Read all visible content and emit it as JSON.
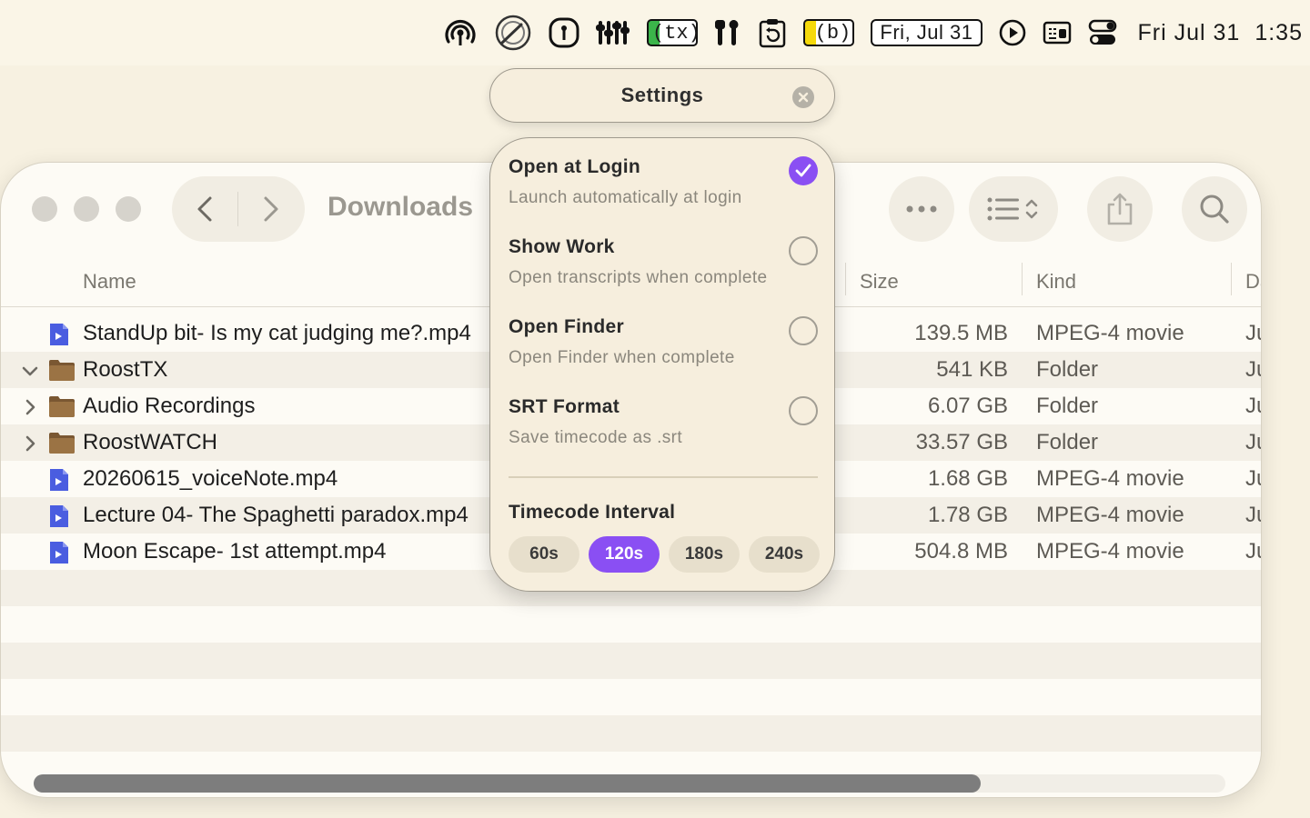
{
  "menubar": {
    "date_box": "Fri, Jul 31",
    "tx_label": "(tx)",
    "b_label": "(b)",
    "clock_date": "Fri Jul 31",
    "clock_time": "1:35"
  },
  "finder": {
    "title": "Downloads",
    "columns": {
      "name": "Name",
      "size": "Size",
      "kind": "Kind",
      "date": "Da"
    },
    "rows": [
      {
        "name": "StandUp bit- Is my cat judging me?.mp4",
        "size": "139.5 MB",
        "kind": "MPEG-4 movie",
        "date": "Ju",
        "type": "movie",
        "chevron": ""
      },
      {
        "name": "RoostTX",
        "size": "541 KB",
        "kind": "Folder",
        "date": "Ju",
        "type": "folder",
        "chevron": "expanded"
      },
      {
        "name": "Audio Recordings",
        "size": "6.07 GB",
        "kind": "Folder",
        "date": "Ju",
        "type": "folder",
        "chevron": "collapsed"
      },
      {
        "name": "RoostWATCH",
        "size": "33.57 GB",
        "kind": "Folder",
        "date": "Ju",
        "type": "folder",
        "chevron": "collapsed"
      },
      {
        "name": "20260615_voiceNote.mp4",
        "size": "1.68 GB",
        "kind": "MPEG-4 movie",
        "date": "Ju",
        "type": "movie",
        "chevron": ""
      },
      {
        "name": "Lecture 04- The Spaghetti paradox.mp4",
        "size": "1.78 GB",
        "kind": "MPEG-4 movie",
        "date": "Ju",
        "type": "movie",
        "chevron": ""
      },
      {
        "name": "Moon Escape- 1st attempt.mp4",
        "size": "504.8 MB",
        "kind": "MPEG-4 movie",
        "date": "Ju",
        "type": "movie",
        "chevron": ""
      }
    ]
  },
  "settings": {
    "title": "Settings",
    "options": [
      {
        "title": "Open at Login",
        "subtitle": "Launch automatically at login",
        "checked": true
      },
      {
        "title": "Show Work",
        "subtitle": "Open transcripts when complete",
        "checked": false
      },
      {
        "title": "Open Finder",
        "subtitle": "Open Finder when complete",
        "checked": false
      },
      {
        "title": "SRT Format",
        "subtitle": "Save timecode as .srt",
        "checked": false
      }
    ],
    "timecode_label": "Timecode Interval",
    "intervals": [
      "60s",
      "120s",
      "180s",
      "240s"
    ],
    "selected_interval": "120s"
  },
  "colors": {
    "accent": "#8a4ff3",
    "background": "#f7f1e1",
    "movie_icon": "#4a5de0",
    "folder_icon": "#8f6a3e"
  }
}
